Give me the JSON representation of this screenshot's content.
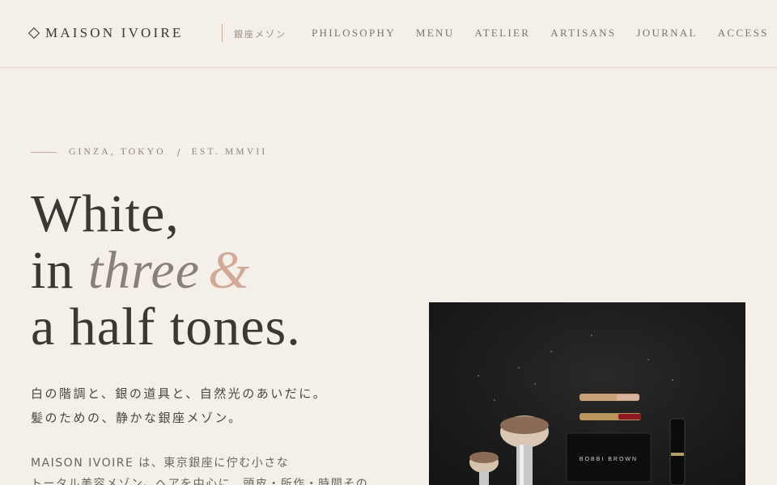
{
  "header": {
    "logo": "MAISON IVOIRE",
    "jp_tag": "銀座メゾン",
    "nav": [
      "PHILOSOPHY",
      "MENU",
      "ATELIER",
      "ARTISANS",
      "JOURNAL",
      "ACCESS"
    ]
  },
  "hero": {
    "eyebrow_place": "GINZA, TOKYO",
    "eyebrow_sep": "/",
    "eyebrow_est": "EST. MMVII",
    "headline": {
      "line1": "White,",
      "line2_a": "in ",
      "line2_b": "three",
      "line2_c": "&",
      "line3": "a half tones."
    },
    "lead": [
      "白の階調と、銀の道具と、自然光のあいだに。",
      "髪のための、静かな銀座メゾン。"
    ],
    "body": [
      "MAISON IVOIRE は、東京銀座に佇む小さな",
      "トータル美容メゾン。ヘアを中心に、頭皮・所作・時間その"
    ]
  },
  "photo": {
    "palette_label": "BOBBI BROWN"
  },
  "colors": {
    "background": "#f4efe9",
    "text": "#3b3733",
    "accent": "#d2a996"
  }
}
